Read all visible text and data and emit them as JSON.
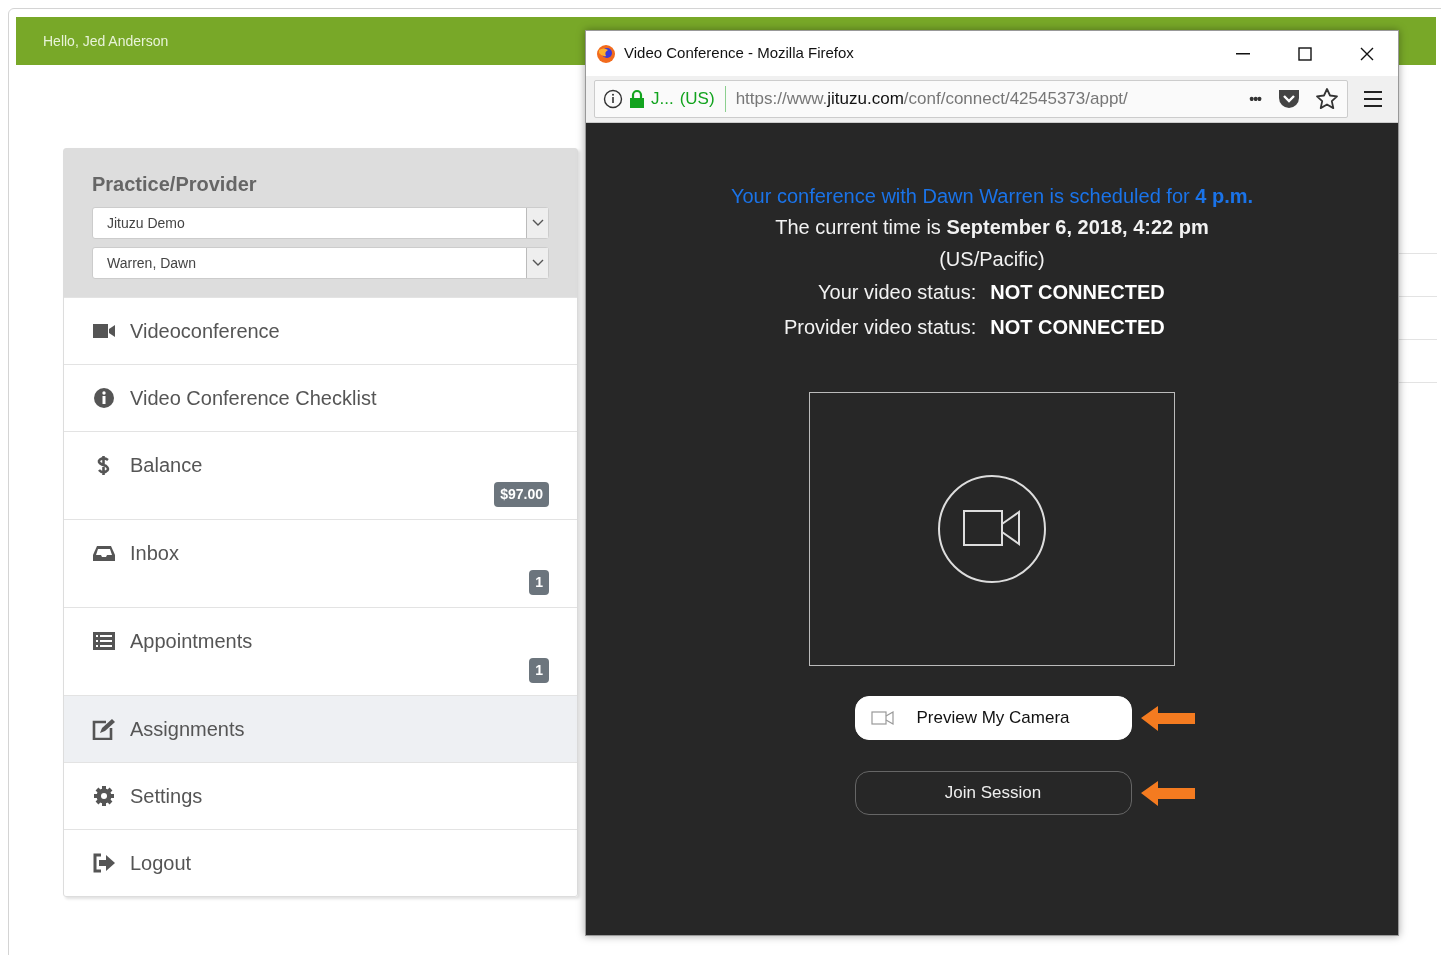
{
  "header": {
    "greeting": "Hello, Jed Anderson"
  },
  "practice_panel": {
    "title": "Practice/Provider",
    "selects": [
      {
        "value": "Jituzu Demo"
      },
      {
        "value": "Warren, Dawn"
      }
    ]
  },
  "sidebar": {
    "items": [
      {
        "label": "Videoconference",
        "selected": false
      },
      {
        "label": "Video Conference Checklist",
        "selected": false
      },
      {
        "label": "Balance",
        "badge": "$97.00",
        "selected": false
      },
      {
        "label": "Inbox",
        "badge": "1",
        "selected": false
      },
      {
        "label": "Appointments",
        "badge": "1",
        "selected": false
      },
      {
        "label": "Assignments",
        "selected": true
      },
      {
        "label": "Settings",
        "selected": false
      },
      {
        "label": "Logout",
        "selected": false
      }
    ]
  },
  "popup": {
    "window": {
      "title": "Video Conference - Mozilla Firefox"
    },
    "address_bar": {
      "site": "J...",
      "country": "(US)",
      "url_prefix": "https://www.",
      "url_domain": "jituzu.com",
      "url_path": "/conf/connect/42545373/appt/",
      "more": "•••"
    },
    "schedule": "Your conference with Dawn Warren is scheduled for **4 p.m.**",
    "current_time": "The current time is **September 6, 2018, 4:22 pm**",
    "timezone": "(US/Pacific)",
    "statuses": [
      {
        "label": "Your video status:",
        "value": "NOT CONNECTED"
      },
      {
        "label": "Provider video status:",
        "value": "NOT CONNECTED"
      }
    ],
    "buttons": [
      {
        "label": "Preview My Camera",
        "kind": "primary"
      },
      {
        "label": "Join Session",
        "kind": "outline"
      }
    ]
  }
}
